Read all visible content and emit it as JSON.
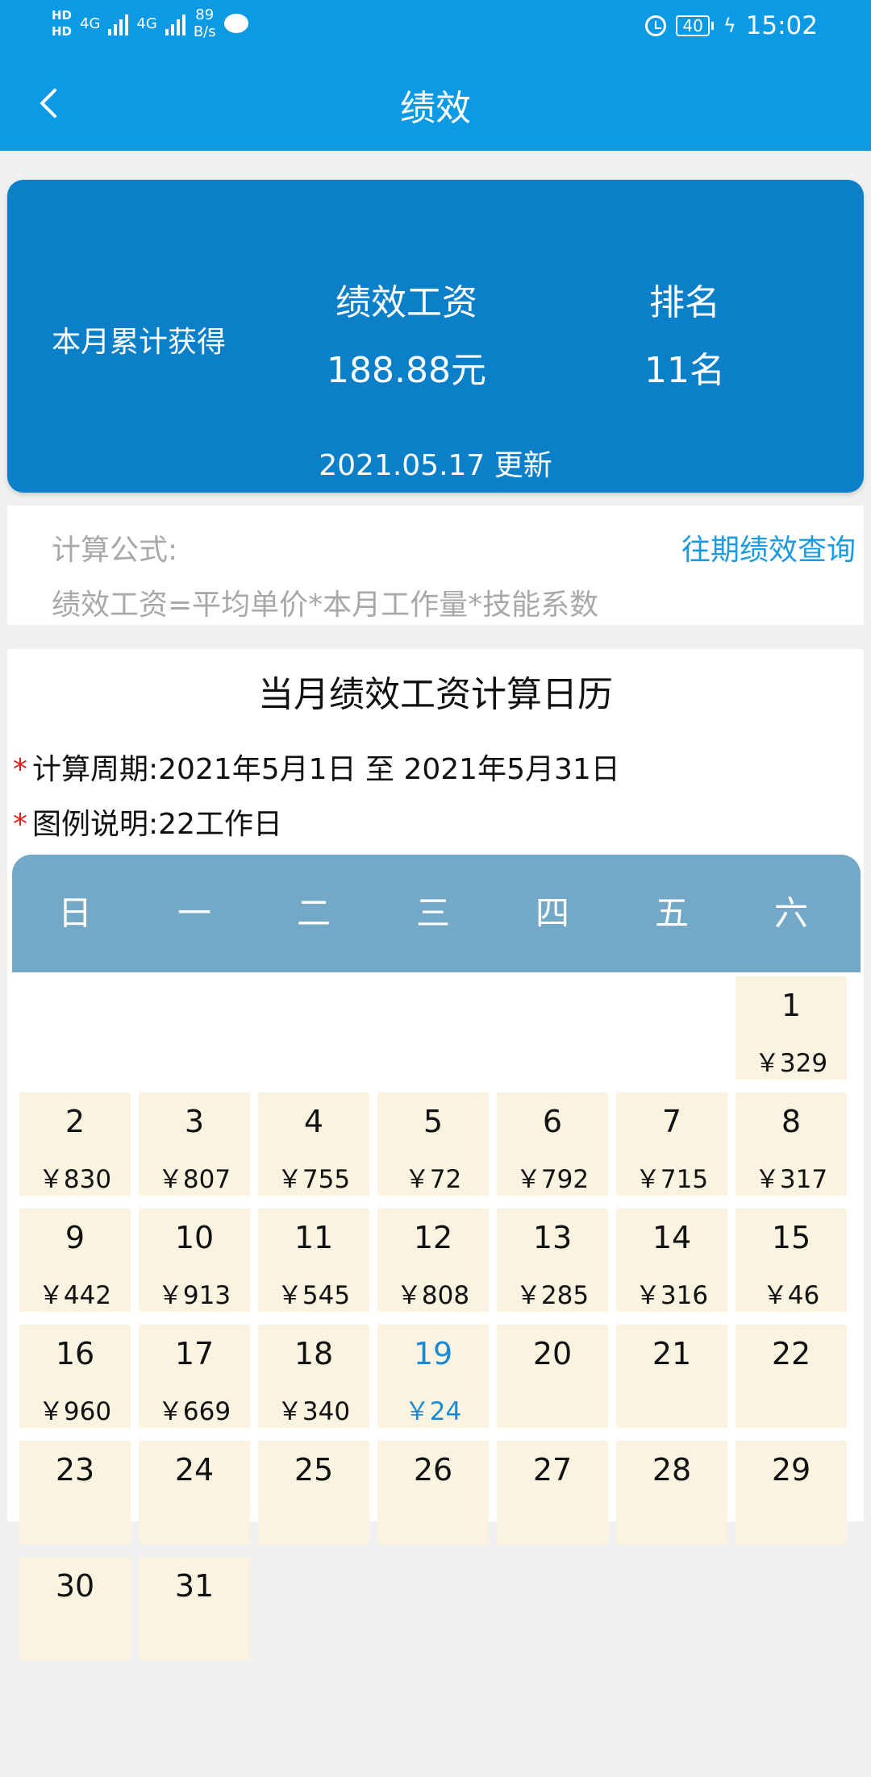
{
  "status_bar": {
    "hd1": "HD",
    "hd2": "HD",
    "net1": "4G",
    "net2": "4G",
    "speed_value": "89",
    "speed_unit": "B/s",
    "battery": "40",
    "time": "15:02"
  },
  "nav": {
    "title": "绩效"
  },
  "summary": {
    "label": "本月累计获得",
    "salary_header": "绩效工资",
    "salary_value": "188.88元",
    "rank_header": "排名",
    "rank_value": "11名",
    "updated": "2021.05.17 更新"
  },
  "formula": {
    "label": "计算公式:",
    "link": "往期绩效查询",
    "text": "绩效工资=平均单价*本月工作量*技能系数"
  },
  "calendar": {
    "title": "当月绩效工资计算日历",
    "period_label": "计算周期:",
    "period_value": "2021年5月1日 至 2021年5月31日",
    "legend_label": "图例说明:",
    "legend_value": "22工作日",
    "weekdays": [
      "日",
      "一",
      "二",
      "三",
      "四",
      "五",
      "六"
    ],
    "first_weekday": 6,
    "today": 19,
    "days": [
      {
        "day": "1",
        "amount": "￥329"
      },
      {
        "day": "2",
        "amount": "￥830"
      },
      {
        "day": "3",
        "amount": "￥807"
      },
      {
        "day": "4",
        "amount": "￥755"
      },
      {
        "day": "5",
        "amount": "￥72"
      },
      {
        "day": "6",
        "amount": "￥792"
      },
      {
        "day": "7",
        "amount": "￥715"
      },
      {
        "day": "8",
        "amount": "￥317"
      },
      {
        "day": "9",
        "amount": "￥442"
      },
      {
        "day": "10",
        "amount": "￥913"
      },
      {
        "day": "11",
        "amount": "￥545"
      },
      {
        "day": "12",
        "amount": "￥808"
      },
      {
        "day": "13",
        "amount": "￥285"
      },
      {
        "day": "14",
        "amount": "￥316"
      },
      {
        "day": "15",
        "amount": "￥46"
      },
      {
        "day": "16",
        "amount": "￥960"
      },
      {
        "day": "17",
        "amount": "￥669"
      },
      {
        "day": "18",
        "amount": "￥340"
      },
      {
        "day": "19",
        "amount": "￥24"
      },
      {
        "day": "20",
        "amount": ""
      },
      {
        "day": "21",
        "amount": ""
      },
      {
        "day": "22",
        "amount": ""
      },
      {
        "day": "23",
        "amount": ""
      },
      {
        "day": "24",
        "amount": ""
      },
      {
        "day": "25",
        "amount": ""
      },
      {
        "day": "26",
        "amount": ""
      },
      {
        "day": "27",
        "amount": ""
      },
      {
        "day": "28",
        "amount": ""
      },
      {
        "day": "29",
        "amount": ""
      },
      {
        "day": "30",
        "amount": ""
      },
      {
        "day": "31",
        "amount": ""
      }
    ]
  },
  "colors": {
    "header": "#0c9ae4",
    "summary": "#0b80c8",
    "weekhead": "#74a8c7",
    "cell": "#f9f3e0",
    "link": "#1a9ae0",
    "today": "#1a8ad6",
    "required_star": "#e02020"
  }
}
